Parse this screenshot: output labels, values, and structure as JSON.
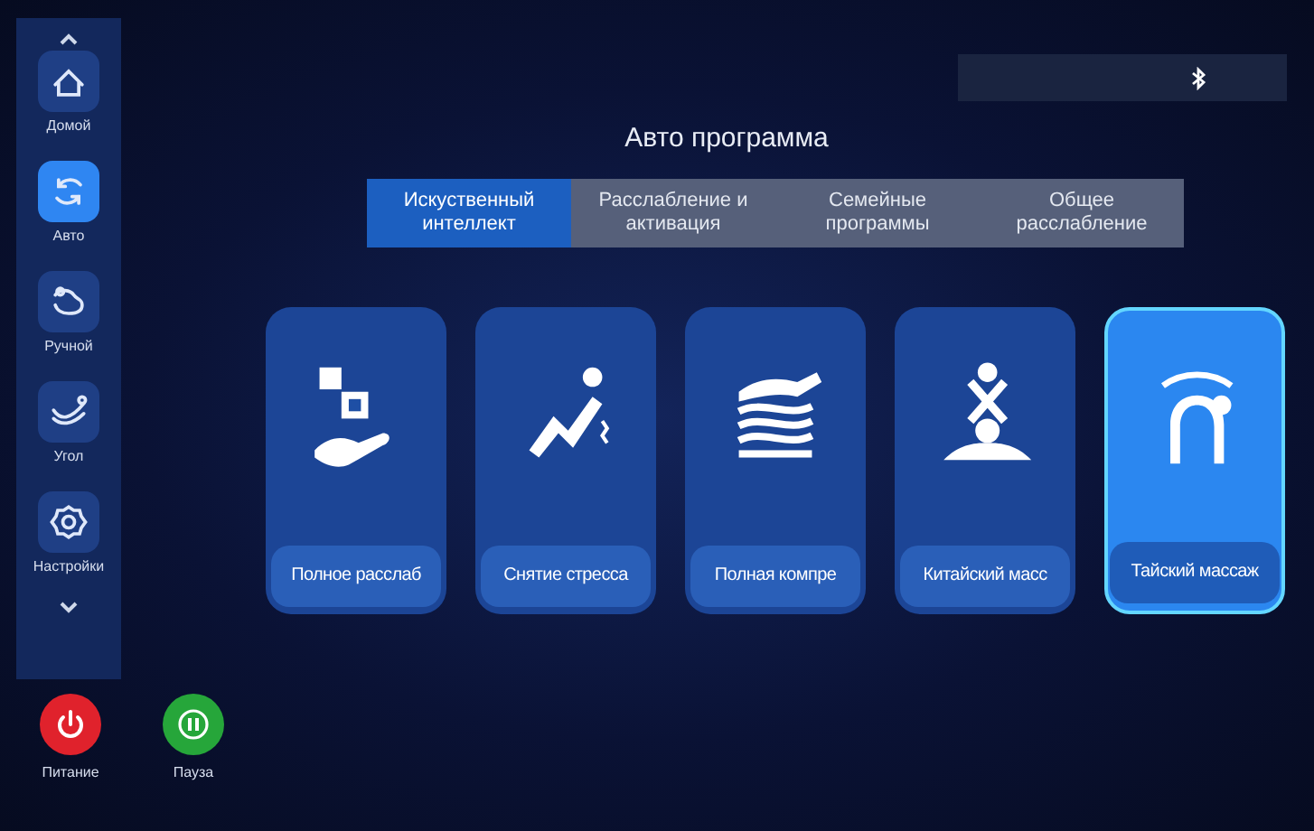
{
  "sidebar": {
    "items": [
      {
        "label": "Домой",
        "kind": "home",
        "selected": false
      },
      {
        "label": "Авто",
        "kind": "auto",
        "selected": true
      },
      {
        "label": "Ручной",
        "kind": "manual",
        "selected": false
      },
      {
        "label": "Угол",
        "kind": "angle",
        "selected": false
      },
      {
        "label": "Настройки",
        "kind": "settings",
        "selected": false
      }
    ]
  },
  "title": "Авто программа",
  "tabs": [
    {
      "label": "Искуственный интеллект",
      "selected": true
    },
    {
      "label": "Расслабление и активация",
      "selected": false
    },
    {
      "label": "Семейные программы",
      "selected": false
    },
    {
      "label": "Общее расслабление",
      "selected": false
    }
  ],
  "programs": [
    {
      "label": "Полное расслаб",
      "kind": "ai",
      "selected": false
    },
    {
      "label": "Снятие стресса",
      "kind": "recline",
      "selected": false
    },
    {
      "label": "Полная компре",
      "kind": "waves",
      "selected": false
    },
    {
      "label": "Китайский масс",
      "kind": "chinese",
      "selected": false
    },
    {
      "label": "Тайский массаж",
      "kind": "thai",
      "selected": true
    }
  ],
  "bottom_buttons": [
    {
      "label": "Питание",
      "kind": "power"
    },
    {
      "label": "Пауза",
      "kind": "pause"
    }
  ]
}
